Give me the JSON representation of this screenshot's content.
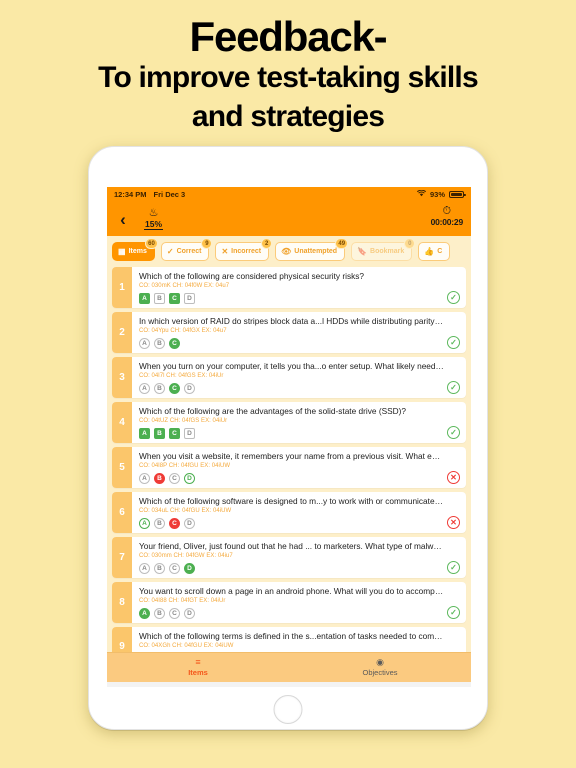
{
  "promo": {
    "line1": "Feedback-",
    "line2": "To improve test-taking skills",
    "line3": "and strategies"
  },
  "colors": {
    "page_bg": "#FAE9A6",
    "accent_orange": "#FF9500",
    "list_bg": "#FDEFC9",
    "row_number_bg": "#FBC66B",
    "correct_green": "#4CAF50",
    "incorrect_red": "#EF3B36",
    "meta_text": "#F4A93C",
    "tabbar_bg": "#FBCA80",
    "tab_selected": "#F4571A"
  },
  "statusbar": {
    "time": "12:34 PM",
    "date": "Fri Dec 3",
    "wifi_icon": "wifi-icon",
    "battery_percent": "93%",
    "battery_icon": "battery-icon"
  },
  "navbar": {
    "back_icon": "chevron-left-icon",
    "progress_icon": "flame-icon",
    "progress_percent": "15%",
    "timer_icon": "clock-icon",
    "timer_value": "00:00:29"
  },
  "filters": [
    {
      "label": "Items",
      "badge": "60",
      "icon": "list-card-icon",
      "state": "active"
    },
    {
      "label": "Correct",
      "badge": "9",
      "icon": "check-icon",
      "state": "normal"
    },
    {
      "label": "Incorrect",
      "badge": "2",
      "icon": "cross-icon",
      "state": "normal"
    },
    {
      "label": "Unattempted",
      "badge": "49",
      "icon": "eye-slash-icon",
      "state": "normal"
    },
    {
      "label": "Bookmark",
      "badge": "0",
      "icon": "bookmark-icon",
      "state": "dim"
    },
    {
      "label": "C",
      "badge": "",
      "icon": "thumbs-up-icon",
      "state": "normal"
    }
  ],
  "items": [
    {
      "number": "1",
      "question": "Which of the following are considered physical security risks?",
      "meta": "CO: 030mK CH: 04f0W EX: 04u7",
      "option_shape": "square",
      "options": [
        {
          "letter": "A",
          "state": "green"
        },
        {
          "letter": "B",
          "state": "plain"
        },
        {
          "letter": "C",
          "state": "green"
        },
        {
          "letter": "D",
          "state": "plain"
        }
      ],
      "status": "correct",
      "status_glyph": "✓"
    },
    {
      "number": "2",
      "question": "In which version of RAID do stripes block data a...l HDDs while distributing parity among th...",
      "meta": "CO: 04Ypu CH: 04fGX EX: 04u7",
      "option_shape": "circle",
      "options": [
        {
          "letter": "A",
          "state": "plain"
        },
        {
          "letter": "B",
          "state": "plain"
        },
        {
          "letter": "C",
          "state": "green"
        }
      ],
      "status": "correct",
      "status_glyph": "✓"
    },
    {
      "number": "3",
      "question": "When you turn on your computer, it tells you tha...o enter setup. What likely needs to be ...",
      "meta": "CO: 04l7l CH: 04fGS EX: 04iUr",
      "option_shape": "circle",
      "options": [
        {
          "letter": "A",
          "state": "plain"
        },
        {
          "letter": "B",
          "state": "plain"
        },
        {
          "letter": "C",
          "state": "green"
        },
        {
          "letter": "D",
          "state": "plain"
        }
      ],
      "status": "correct",
      "status_glyph": "✓"
    },
    {
      "number": "4",
      "question": "Which of the following are the advantages of the solid-state drive (SSD)?",
      "meta": "CO: 04tUZ CH: 04fGS EX: 04iUr",
      "option_shape": "square",
      "options": [
        {
          "letter": "A",
          "state": "green"
        },
        {
          "letter": "B",
          "state": "green"
        },
        {
          "letter": "C",
          "state": "green"
        },
        {
          "letter": "D",
          "state": "plain"
        }
      ],
      "status": "correct",
      "status_glyph": "✓"
    },
    {
      "number": "5",
      "question": "When you visit a website, it remembers your name from a previous visit. What enables this...",
      "meta": "CO: 04l8P CH: 04fGU EX: 04iUW",
      "option_shape": "circle",
      "options": [
        {
          "letter": "A",
          "state": "plain"
        },
        {
          "letter": "B",
          "state": "red"
        },
        {
          "letter": "C",
          "state": "plain"
        },
        {
          "letter": "D",
          "state": "greenline"
        }
      ],
      "status": "incorrect",
      "status_glyph": "✕"
    },
    {
      "number": "6",
      "question": "Which of the following software is designed to m...y to work with or communicate with ...",
      "meta": "CO: 034uL CH: 04fGU EX: 04iUW",
      "option_shape": "circle",
      "options": [
        {
          "letter": "A",
          "state": "greenline"
        },
        {
          "letter": "B",
          "state": "plain"
        },
        {
          "letter": "C",
          "state": "red"
        },
        {
          "letter": "D",
          "state": "plain"
        }
      ],
      "status": "incorrect",
      "status_glyph": "✕"
    },
    {
      "number": "7",
      "question": "Your friend, Oliver, just found out that he had ... to marketers. What type of malware did he ...",
      "meta": "CO: 030mm CH: 04fGW EX: 04iu7",
      "option_shape": "circle",
      "options": [
        {
          "letter": "A",
          "state": "plain"
        },
        {
          "letter": "B",
          "state": "plain"
        },
        {
          "letter": "C",
          "state": "plain"
        },
        {
          "letter": "D",
          "state": "green"
        }
      ],
      "status": "correct",
      "status_glyph": "✓"
    },
    {
      "number": "8",
      "question": "You want to scroll down a page in an android phone. What will you do to accomplish this ...",
      "meta": "CO: 04I88 CH: 04fGT EX: 04iUr",
      "option_shape": "circle",
      "options": [
        {
          "letter": "A",
          "state": "green"
        },
        {
          "letter": "B",
          "state": "plain"
        },
        {
          "letter": "C",
          "state": "plain"
        },
        {
          "letter": "D",
          "state": "plain"
        }
      ],
      "status": "correct",
      "status_glyph": "✓"
    },
    {
      "number": "9",
      "question": "Which of the following terms is defined in the s...entation of tasks needed to complete a ...",
      "meta": "CO: 04XGh CH: 04fGU EX: 04iUW",
      "option_shape": "circle",
      "options": [],
      "status": "none",
      "status_glyph": ""
    }
  ],
  "tabbar": [
    {
      "label": "Items",
      "icon": "list-icon",
      "selected": true
    },
    {
      "label": "Objectives",
      "icon": "target-icon",
      "selected": false
    }
  ]
}
